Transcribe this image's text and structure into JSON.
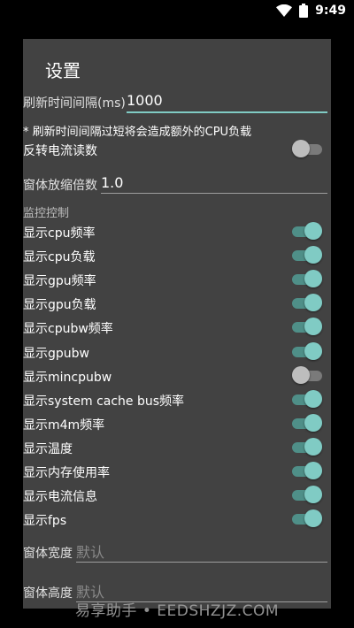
{
  "status_bar": {
    "time": "9:49",
    "wifi_icon": "wifi-icon",
    "battery_icon": "battery-icon"
  },
  "dialog": {
    "title": "设置",
    "refresh": {
      "label": "刷新时间间隔(ms)",
      "value": "1000",
      "hint": "* 刷新时间间隔过短将会造成额外的CPU负载"
    },
    "reverse_current": {
      "label": "反转电流读数",
      "on": false
    },
    "scale": {
      "label": "窗体放缩倍数",
      "value": "1.0"
    },
    "monitor_section": "监控控制",
    "toggles": [
      {
        "label": "显示cpu频率",
        "on": true
      },
      {
        "label": "显示cpu负载",
        "on": true
      },
      {
        "label": "显示gpu频率",
        "on": true
      },
      {
        "label": "显示gpu负载",
        "on": true
      },
      {
        "label": "显示cpubw频率",
        "on": true
      },
      {
        "label": "显示gpubw",
        "on": true
      },
      {
        "label": "显示mincpubw",
        "on": false
      },
      {
        "label": "显示system cache bus频率",
        "on": true
      },
      {
        "label": "显示m4m频率",
        "on": true
      },
      {
        "label": "显示温度",
        "on": true
      },
      {
        "label": "显示内存使用率",
        "on": true
      },
      {
        "label": "显示电流信息",
        "on": true
      },
      {
        "label": "显示fps",
        "on": true
      }
    ],
    "width": {
      "label": "窗体宽度",
      "placeholder": "默认"
    },
    "height": {
      "label": "窗体高度",
      "placeholder": "默认"
    }
  },
  "watermark": "易享助手 • EEDSHZJZ.COM",
  "colors": {
    "accent": "#80cbc4",
    "dialog_bg": "#424242",
    "page_bg": "#000000"
  }
}
